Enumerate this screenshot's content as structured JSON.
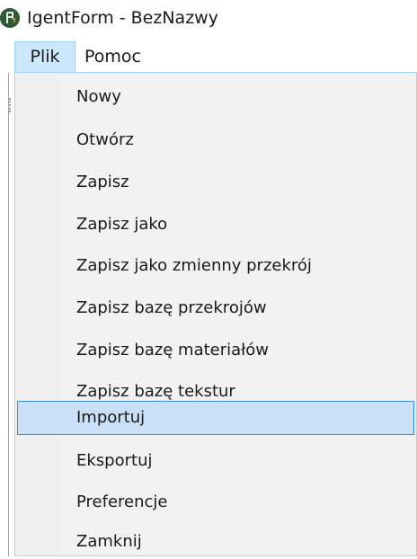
{
  "window": {
    "title": "IgentForm - BezNazwy",
    "icon": "app-logo-icon"
  },
  "menubar": {
    "items": [
      "Plik",
      "Pomoc"
    ],
    "active": "Plik"
  },
  "file_menu": {
    "items": [
      "Nowy",
      "Otwórz",
      "Zapisz",
      "Zapisz jako",
      "Zapisz jako zmienny przekrój",
      "Zapisz bazę przekrojów",
      "Zapisz bazę materiałów",
      "Zapisz bazę tekstur",
      "Importuj",
      "Eksportuj",
      "Preferencje",
      "Zamknij"
    ],
    "highlighted": "Importuj"
  },
  "colors": {
    "highlight_fill": "#c9e0f7",
    "highlight_border": "#3e8ee0",
    "menu_active_fill": "#cce8ff",
    "menu_background": "#f2f2f2",
    "app_icon": "#2f5a3a"
  }
}
